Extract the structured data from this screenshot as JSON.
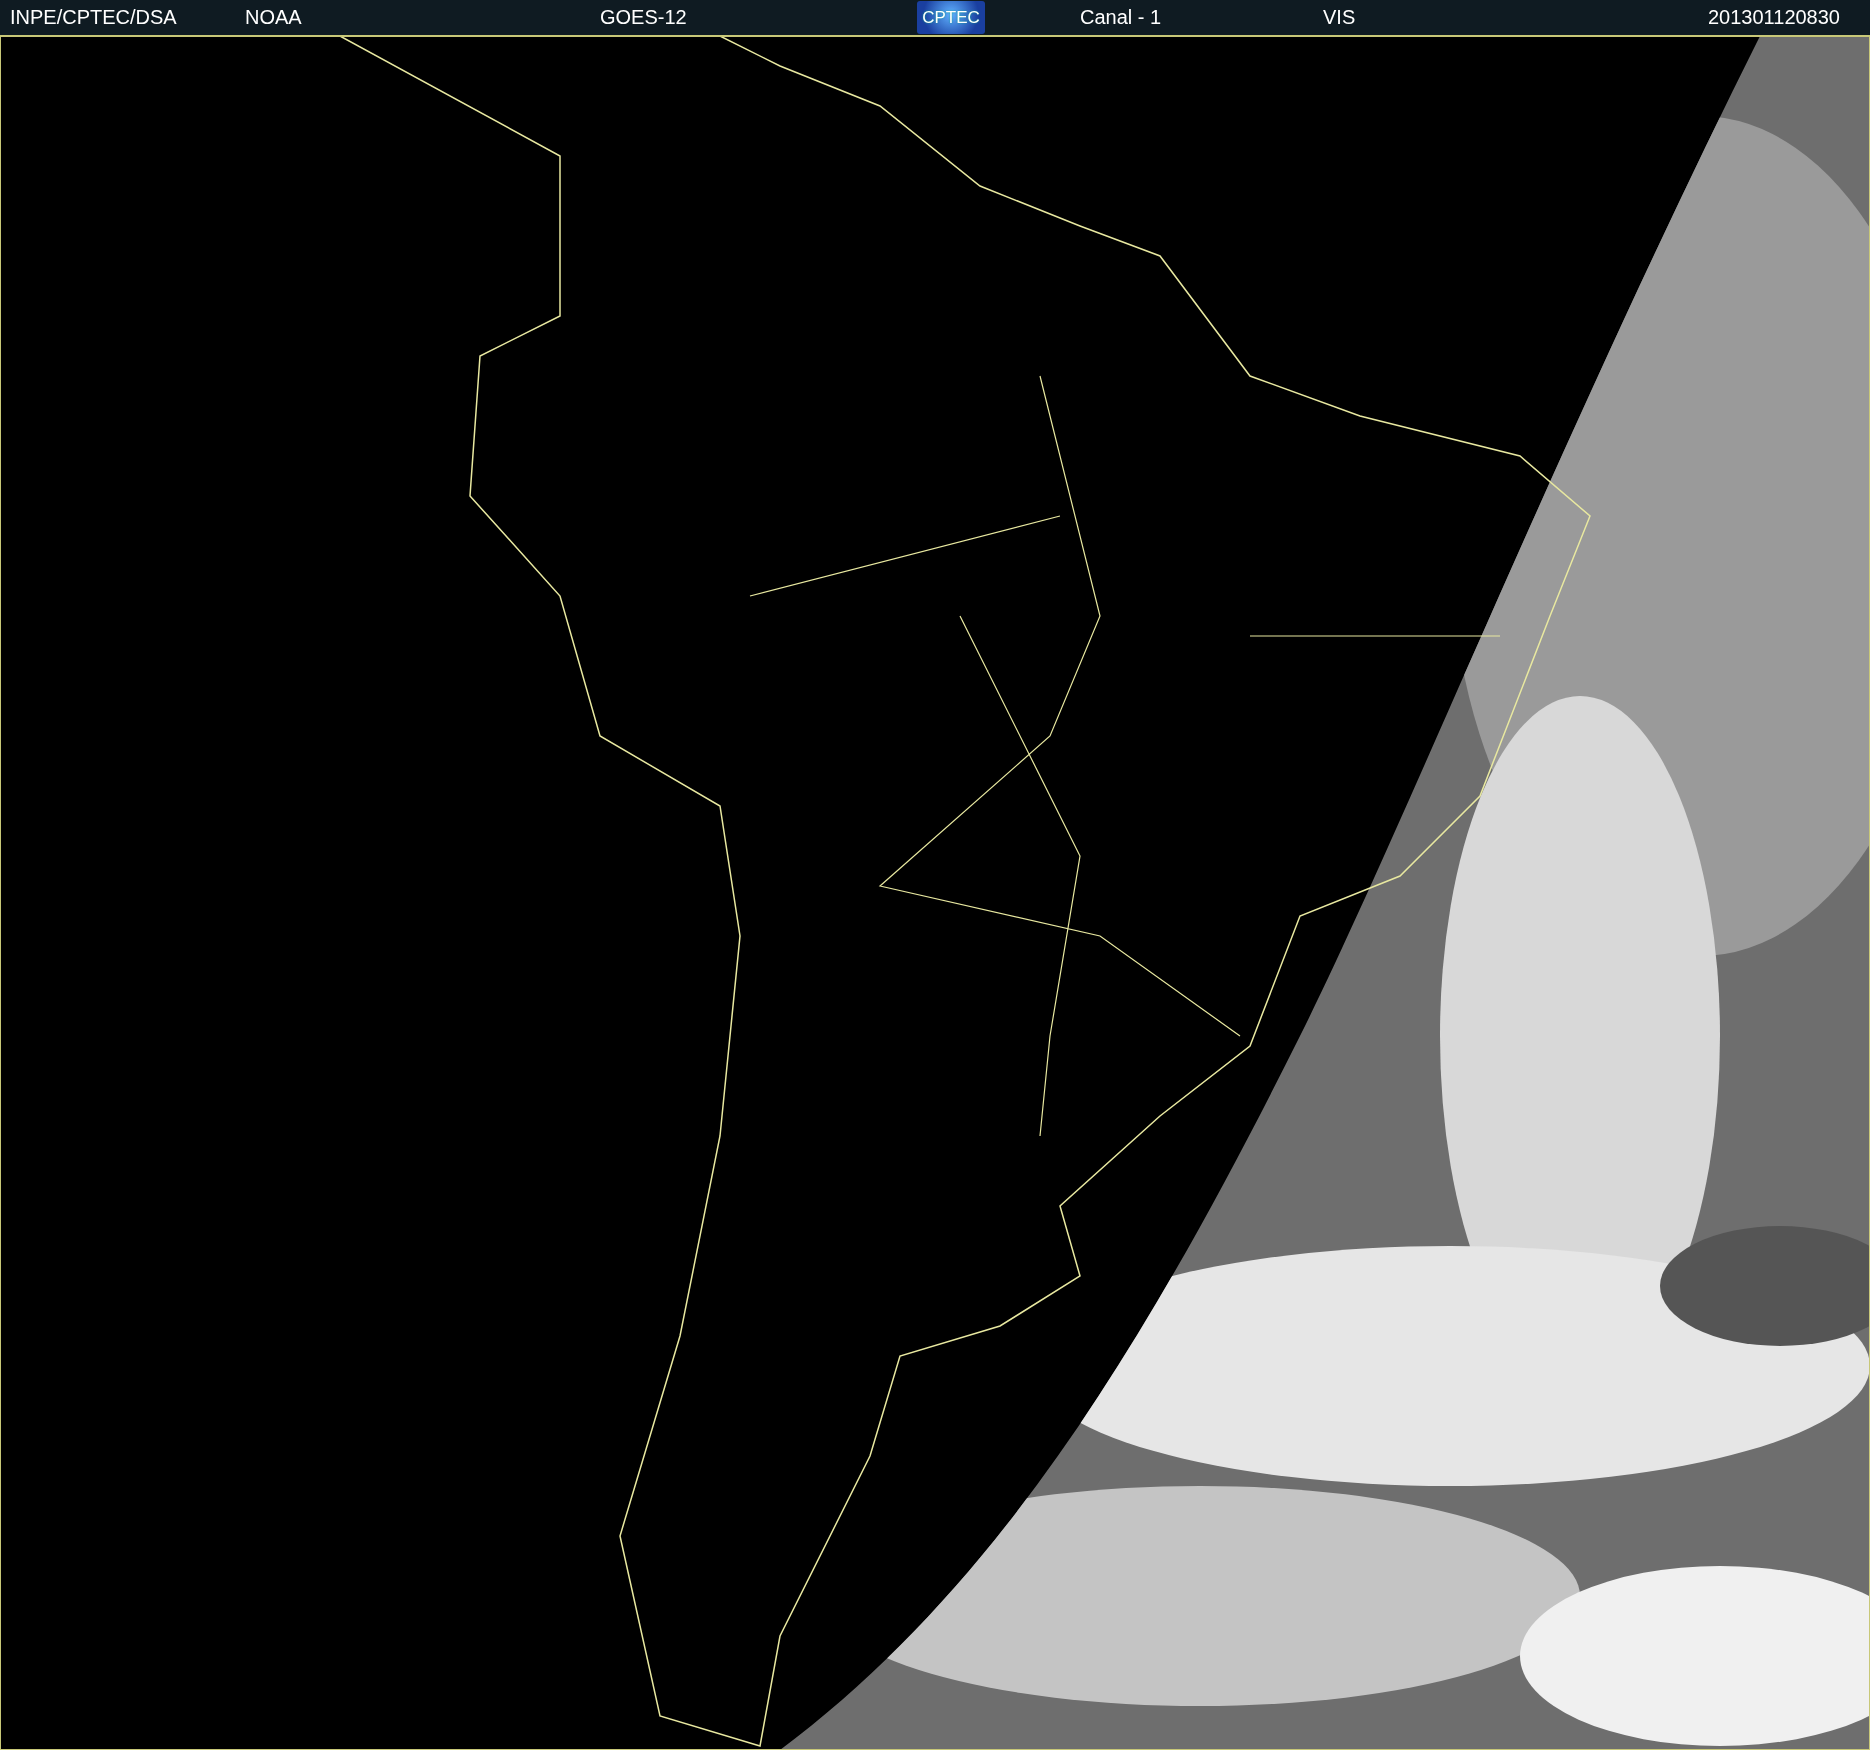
{
  "header": {
    "items": [
      {
        "kind": "text",
        "text": "INPE/CPTEC/DSA"
      },
      {
        "kind": "text",
        "text": "NOAA"
      },
      {
        "kind": "text",
        "text": "GOES-12"
      },
      {
        "kind": "logo",
        "text": "CPTEC"
      },
      {
        "kind": "text",
        "text": "Canal - 1"
      },
      {
        "kind": "text",
        "text": "VIS"
      },
      {
        "kind": "text",
        "text": "201301120830"
      }
    ]
  }
}
